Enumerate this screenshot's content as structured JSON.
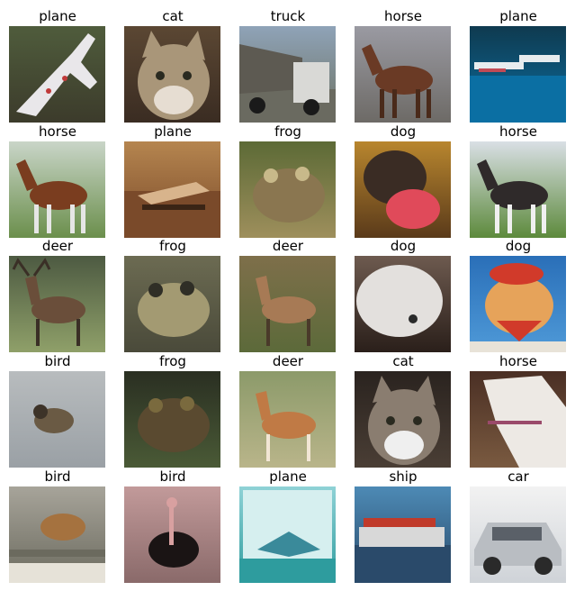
{
  "grid": {
    "rows": 5,
    "columns": 5,
    "cells": [
      {
        "label": "plane",
        "scene": "plane-white-on-grass",
        "colors": {
          "bg": "#4f5c3c",
          "bg2": "#3c3b2b",
          "subject": "#e9e7ea",
          "accent": "#c03a3a"
        }
      },
      {
        "label": "cat",
        "scene": "cat-closeup",
        "colors": {
          "bg": "#5b4733",
          "bg2": "#3a2c22",
          "subject": "#a99679",
          "accent": "#e6ddd2"
        }
      },
      {
        "label": "truck",
        "scene": "truck-dump",
        "colors": {
          "bg": "#8fa3b8",
          "bg2": "#6c7160",
          "subject": "#d9d9d6",
          "accent": "#5d5a52"
        }
      },
      {
        "label": "horse",
        "scene": "horse-brown-standing",
        "colors": {
          "bg": "#9a9aa2",
          "bg2": "#6d6a66",
          "subject": "#6a3a25",
          "accent": "#4a2a1a"
        }
      },
      {
        "label": "plane",
        "scene": "seaplane-on-water",
        "colors": {
          "bg": "#0f3a4f",
          "bg2": "#0b6fa3",
          "subject": "#e7ecef",
          "accent": "#c24a55"
        }
      },
      {
        "label": "horse",
        "scene": "horse-bay-side",
        "colors": {
          "bg": "#c9d5c8",
          "bg2": "#6b8f4c",
          "subject": "#7a3d1f",
          "accent": "#e6e6e6"
        }
      },
      {
        "label": "plane",
        "scene": "plane-sunset-ground",
        "colors": {
          "bg": "#b5854f",
          "bg2": "#7a4a2a",
          "subject": "#d8b48c",
          "accent": "#3a2415"
        }
      },
      {
        "label": "frog",
        "scene": "frog-brown-closeup",
        "colors": {
          "bg": "#5c6a36",
          "bg2": "#9e8f5c",
          "subject": "#8a7650",
          "accent": "#c8b98a"
        }
      },
      {
        "label": "dog",
        "scene": "dog-with-red-toy",
        "colors": {
          "bg": "#b8862e",
          "bg2": "#5a3a1a",
          "subject": "#3a2c24",
          "accent": "#e04a5a"
        }
      },
      {
        "label": "horse",
        "scene": "horse-dark-fence",
        "colors": {
          "bg": "#d9dfe5",
          "bg2": "#5d8a3c",
          "subject": "#2f2a2a",
          "accent": "#f0f0f0"
        }
      },
      {
        "label": "deer",
        "scene": "deer-stag-field",
        "colors": {
          "bg": "#4d5a42",
          "bg2": "#8fa069",
          "subject": "#6a4e3a",
          "accent": "#3a2f26"
        }
      },
      {
        "label": "frog",
        "scene": "frog-grey-ground",
        "colors": {
          "bg": "#6c6b52",
          "bg2": "#4a4a3a",
          "subject": "#a39a72",
          "accent": "#2f2e26"
        }
      },
      {
        "label": "deer",
        "scene": "deer-brown-grass",
        "colors": {
          "bg": "#7e6f4a",
          "bg2": "#5c6a3a",
          "subject": "#a77a55",
          "accent": "#4a3a2a"
        }
      },
      {
        "label": "dog",
        "scene": "dog-white-fluffy",
        "colors": {
          "bg": "#6d5a4f",
          "bg2": "#2a1f1a",
          "subject": "#e3e0dd",
          "accent": "#a28f85"
        }
      },
      {
        "label": "dog",
        "scene": "dog-red-hat",
        "colors": {
          "bg": "#2a6fb8",
          "bg2": "#4f9ad8",
          "subject": "#e6a35a",
          "accent": "#d13a2a"
        }
      },
      {
        "label": "bird",
        "scene": "bird-on-grey",
        "colors": {
          "bg": "#b8bcbe",
          "bg2": "#9aa0a5",
          "subject": "#6a5a44",
          "accent": "#3d3328"
        }
      },
      {
        "label": "frog",
        "scene": "frog-dark-leaves",
        "colors": {
          "bg": "#2a2f22",
          "bg2": "#4a5a36",
          "subject": "#5a4a30",
          "accent": "#7a6a3e"
        }
      },
      {
        "label": "deer",
        "scene": "deer-doe-field",
        "colors": {
          "bg": "#8c9a6a",
          "bg2": "#b9b58a",
          "subject": "#c07a45",
          "accent": "#f2e6d5"
        }
      },
      {
        "label": "cat",
        "scene": "cat-tabby-front",
        "colors": {
          "bg": "#2a231f",
          "bg2": "#4a3e35",
          "subject": "#8a7d70",
          "accent": "#efefef"
        }
      },
      {
        "label": "horse",
        "scene": "horse-white-head",
        "colors": {
          "bg": "#4a2f24",
          "bg2": "#7a5a40",
          "subject": "#ede9e4",
          "accent": "#9a4a6a"
        }
      },
      {
        "label": "bird",
        "scene": "bird-on-branch",
        "colors": {
          "bg": "#a7a49a",
          "bg2": "#6b6a5e",
          "subject": "#a5723f",
          "accent": "#e6e2d8"
        }
      },
      {
        "label": "bird",
        "scene": "ostrich-black",
        "colors": {
          "bg": "#c29a9a",
          "bg2": "#8a6a6a",
          "subject": "#1a1414",
          "accent": "#d8a0a0"
        }
      },
      {
        "label": "plane",
        "scene": "jet-teal-frame",
        "colors": {
          "bg": "#8fd2d6",
          "bg2": "#2e9c9e",
          "subject": "#3a8a9a",
          "accent": "#d6efef"
        }
      },
      {
        "label": "ship",
        "scene": "ship-container-sea",
        "colors": {
          "bg": "#4d8ab5",
          "bg2": "#2a4a6a",
          "subject": "#d8d8d8",
          "accent": "#c03a2a"
        }
      },
      {
        "label": "car",
        "scene": "car-silver",
        "colors": {
          "bg": "#f2f2f2",
          "bg2": "#cfd3d8",
          "subject": "#b9bdc2",
          "accent": "#2a2a2a"
        }
      }
    ]
  }
}
